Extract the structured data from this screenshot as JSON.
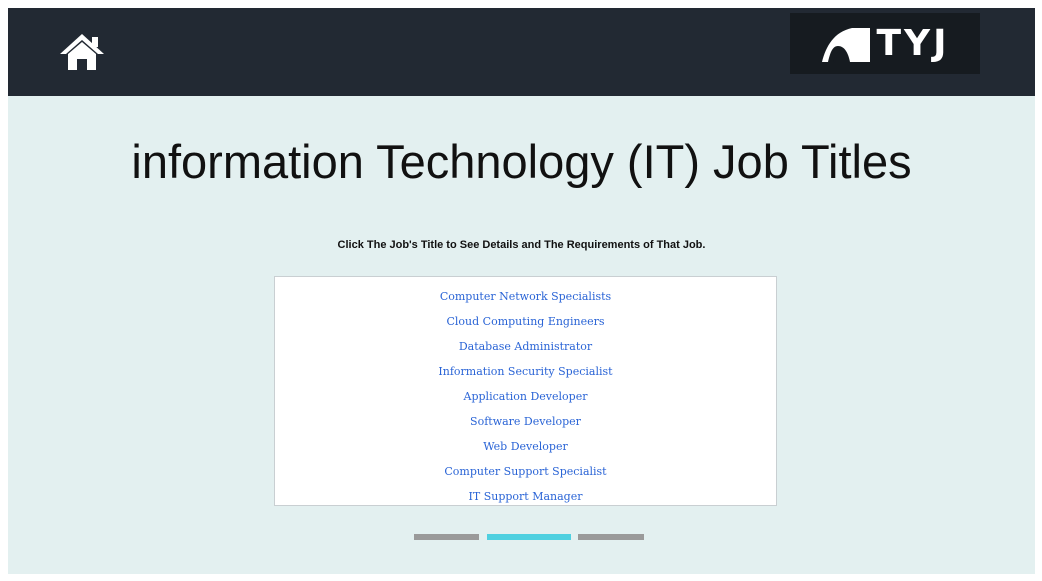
{
  "header": {
    "home_icon": "home-icon",
    "logo_text": "TYJ",
    "logo_icon": "road-icon"
  },
  "page": {
    "title": "information Technology (IT) Job Titles",
    "instruction": "Click The Job's Title to See Details and The Requirements of That Job."
  },
  "jobs": [
    {
      "label": "Computer Network Specialists"
    },
    {
      "label": "Cloud Computing Engineers"
    },
    {
      "label": "Database Administrator"
    },
    {
      "label": "Information Security Specialist"
    },
    {
      "label": "Application Developer"
    },
    {
      "label": "Software Developer"
    },
    {
      "label": "Web Developer"
    },
    {
      "label": "Computer Support Specialist"
    },
    {
      "label": "IT Support Manager"
    }
  ],
  "pager": {
    "pages": 3,
    "active_index": 1,
    "active_color": "#4fd0e0",
    "inactive_color": "#9a9a9a"
  },
  "colors": {
    "header_bg": "#222933",
    "page_bg": "#e3f0f0",
    "link": "#2a64d6"
  }
}
